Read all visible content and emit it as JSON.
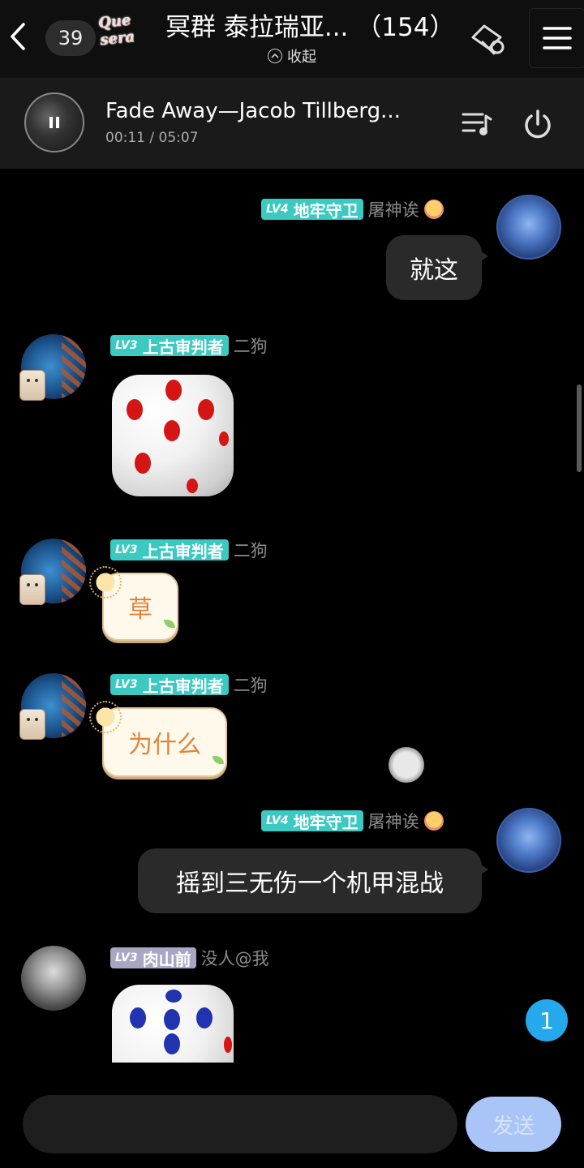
{
  "header": {
    "back_icon": "chevron-left-icon",
    "unread_count": "39",
    "logo_text": "Que sera",
    "group_title": "冥群 泰拉瑞亚... （154）",
    "collapse_label": "收起",
    "exit_icon": "exit-group-icon",
    "menu_icon": "menu-icon"
  },
  "music": {
    "song_title": "Fade Away—Jacob Tillberg...",
    "time": "00:11 / 05:07",
    "playlist_icon": "playlist-icon",
    "power_icon": "power-icon"
  },
  "messages": [
    {
      "side": "right",
      "level": "LV4",
      "rank": "地牢守卫",
      "nickname": "屠神诶",
      "text": "就这"
    },
    {
      "side": "left",
      "level": "LV3",
      "rank": "上古审判者",
      "nickname": "二狗",
      "dice_value": 5
    },
    {
      "side": "left",
      "level": "LV3",
      "rank": "上古审判者",
      "nickname": "二狗",
      "text": "草"
    },
    {
      "side": "left",
      "level": "LV3",
      "rank": "上古审判者",
      "nickname": "二狗",
      "text": "为什么"
    },
    {
      "side": "right",
      "level": "LV4",
      "rank": "地牢守卫",
      "nickname": "屠神诶",
      "text": "摇到三无伤一个机甲混战"
    },
    {
      "side": "left",
      "level": "LV3",
      "rank": "肉山前",
      "nickname": "没人@我",
      "dice_value": 5
    }
  ],
  "new_message_count": "1",
  "input": {
    "placeholder": "",
    "send_label": "发送"
  },
  "colors": {
    "badge_teal": "#3cc9c2",
    "badge_gray": "#a8a6c4",
    "dice_red": "#d51414",
    "dice_blue": "#2233b0",
    "new_msg_badge": "#25a9ec",
    "send_button": "#a9c4f6"
  }
}
